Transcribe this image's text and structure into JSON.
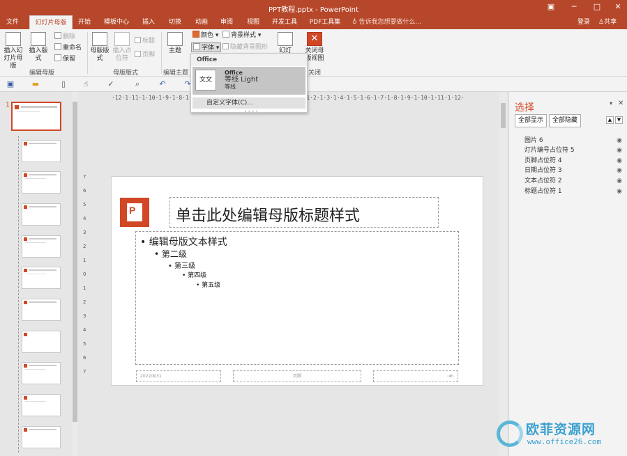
{
  "window": {
    "title": "PPT教程.pptx - PowerPoint",
    "controls": [
      "▣",
      "─",
      "□",
      "✕"
    ]
  },
  "tabs": [
    {
      "label": "文件",
      "active": false
    },
    {
      "label": "幻灯片母版",
      "active": true
    },
    {
      "label": "开始",
      "active": false
    },
    {
      "label": "模板中心",
      "active": false
    },
    {
      "label": "插入",
      "active": false
    },
    {
      "label": "切换",
      "active": false
    },
    {
      "label": "动画",
      "active": false
    },
    {
      "label": "审阅",
      "active": false
    },
    {
      "label": "视图",
      "active": false
    },
    {
      "label": "开发工具",
      "active": false
    },
    {
      "label": "PDF工具集",
      "active": false
    }
  ],
  "tell_me": "告诉我您想要做什么...",
  "account": {
    "login": "登录",
    "share": "共享"
  },
  "ribbon": {
    "insert_master": "插入幻灯片母版",
    "insert_layout": "插入版式",
    "delete": "删除",
    "rename": "重命名",
    "preserve": "保留",
    "master_layout": "母版版式",
    "insert_placeholder": "插入占位符",
    "title_check": "标题",
    "footer_check": "页脚",
    "themes": "主题",
    "colors": "颜色",
    "fonts": "字体",
    "background_styles": "背景样式",
    "hide_background": "隐藏背景图形",
    "slide_size": "幻灯片",
    "close_master": "关闭母版视图",
    "groups": {
      "edit_master": "编辑母版",
      "master_layout": "母版版式",
      "edit_theme": "编辑主题",
      "close": "关闭"
    }
  },
  "font_dropdown": {
    "header": "Office",
    "item": {
      "name": "Office",
      "heading_font": "等线 Light",
      "body_font": "等线",
      "preview": "文文"
    },
    "customize": "自定义字体(C)..."
  },
  "ruler": {
    "horizontal": "·12·1·11·1·10·1·9·1·8·1·7·1·6·1·5·1·4·1·3·1·2·1·1·1·0·1·1·1·2·1·3·1·4·1·5·1·6·1·7·1·8·1·9·1·10·1·11·1·12·",
    "vertical": [
      "7",
      "6",
      "5",
      "4",
      "3",
      "2",
      "1",
      "0",
      "1",
      "2",
      "3",
      "4",
      "5",
      "6",
      "7"
    ]
  },
  "thumbnails": {
    "first_number": "1",
    "count": 11
  },
  "slide": {
    "title": "单击此处编辑母版标题样式",
    "body_levels": [
      "编辑母版文本样式",
      "第二级",
      "第三级",
      "第四级",
      "第五级"
    ],
    "footer_date": "2022/8/31",
    "footer_text": "页脚",
    "footer_number": "‹#›"
  },
  "selection_pane": {
    "title": "选择",
    "show_all": "全部显示",
    "hide_all": "全部隐藏",
    "items": [
      "图片 6",
      "灯片编号占位符 5",
      "页脚占位符 4",
      "日期占位符 3",
      "文本占位符 2",
      "标题占位符 1"
    ]
  },
  "watermark": {
    "cn": "欧菲资源网",
    "url": "www.office26.com"
  },
  "colors": {
    "accent": "#b7472a",
    "logo": "#d24726"
  }
}
